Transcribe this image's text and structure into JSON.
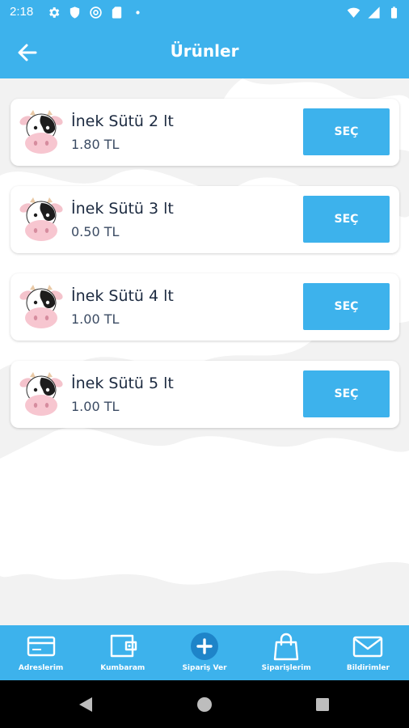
{
  "status_bar": {
    "time": "2:18",
    "left_icons": [
      "gear-icon",
      "shield-icon",
      "at-sign-icon",
      "sd-card-icon",
      "dot-icon"
    ],
    "right_icons": [
      "wifi-icon",
      "signal-icon",
      "battery-icon"
    ]
  },
  "header": {
    "title": "Ürünler",
    "back_icon": "arrow-left-icon"
  },
  "products": [
    {
      "name": "İnek Sütü 2 lt",
      "price": "1.80 TL",
      "button": "SEÇ"
    },
    {
      "name": "İnek Sütü 3 lt",
      "price": "0.50 TL",
      "button": "SEÇ"
    },
    {
      "name": "İnek Sütü 4 lt",
      "price": "1.00 TL",
      "button": "SEÇ"
    },
    {
      "name": "İnek Sütü 5 lt",
      "price": "1.00 TL",
      "button": "SEÇ"
    }
  ],
  "bottom_nav": [
    {
      "label": "Adreslerim",
      "icon": "card-icon"
    },
    {
      "label": "Kumbaram",
      "icon": "wallet-icon"
    },
    {
      "label": "Sipariş Ver",
      "icon": "plus-circle-icon"
    },
    {
      "label": "Siparişlerim",
      "icon": "shopping-bag-icon"
    },
    {
      "label": "Bildirimler",
      "icon": "mail-icon"
    }
  ],
  "colors": {
    "primary": "#3db2ec",
    "text_dark": "#1c2a40",
    "text_price": "#3b4b63",
    "background": "#f2f2f2"
  }
}
